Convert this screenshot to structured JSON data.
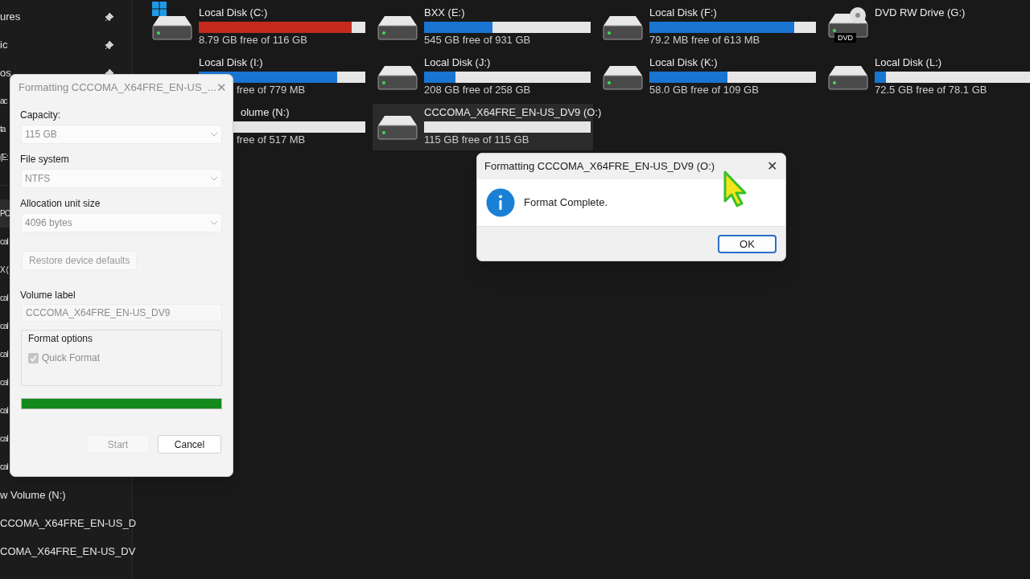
{
  "sidebar": {
    "sections": [
      {
        "items": [
          {
            "label": "ures",
            "pinned": true,
            "selected": false
          },
          {
            "label": "ic",
            "pinned": true,
            "selected": false
          },
          {
            "label": "os",
            "pinned": true,
            "selected": false
          },
          {
            "label": "ac",
            "selected": false
          },
          {
            "label": "ta",
            "selected": false
          },
          {
            "label": "(E:",
            "selected": false
          }
        ]
      },
      {
        "items": [
          {
            "label": "PC",
            "selected": true
          },
          {
            "label": "cal",
            "selected": false
          },
          {
            "label": "X (",
            "selected": false
          },
          {
            "label": "cal",
            "selected": false
          },
          {
            "label": "cal",
            "selected": false
          },
          {
            "label": "cal",
            "selected": false
          },
          {
            "label": "cal",
            "selected": false
          },
          {
            "label": "cal",
            "selected": false
          },
          {
            "label": "cal",
            "selected": false
          },
          {
            "label": "cal",
            "selected": false
          },
          {
            "label": "w Volume (N:)",
            "selected": false
          },
          {
            "label": "CCOMA_X64FRE_EN-US_D",
            "selected": false
          },
          {
            "label": "COMA_X64FRE_EN-US_DV",
            "selected": false
          }
        ]
      }
    ]
  },
  "drives": [
    {
      "kind": "disk",
      "label": "Local Disk (C:)",
      "level": 0.92,
      "low_space": true,
      "space": "8.79 GB free of 116 GB",
      "system": true,
      "selected": false
    },
    {
      "kind": "disk",
      "label": "BXX (E:)",
      "level": 0.41,
      "low_space": false,
      "space": "545 GB free of 931 GB",
      "system": false,
      "selected": false
    },
    {
      "kind": "disk",
      "label": "Local Disk (F:)",
      "level": 0.87,
      "low_space": false,
      "space": "79.2 MB free of 613 MB",
      "system": false,
      "selected": false
    },
    {
      "kind": "dvd",
      "label": "DVD RW Drive (G:)",
      "badge": "DVD",
      "selected": false
    },
    {
      "kind": "disk",
      "label": "Local Disk (I:)",
      "level": 0.83,
      "low_space": false,
      "space": "free of 779 MB",
      "selected": false
    },
    {
      "kind": "disk",
      "label": "Local Disk (J:)",
      "level": 0.19,
      "low_space": false,
      "space": "208 GB free of 258 GB",
      "system": false,
      "selected": false
    },
    {
      "kind": "disk",
      "label": "Local Disk (K:)",
      "level": 0.47,
      "low_space": false,
      "space": "58.0 GB free of 109 GB",
      "system": false,
      "selected": false
    },
    {
      "kind": "disk",
      "label": "Local Disk (L:)",
      "level": 0.07,
      "low_space": false,
      "space": "72.5 GB free of 78.1 GB",
      "system": false,
      "selected": false
    },
    {
      "kind": "disk",
      "label": "olume (N:)",
      "level": 0,
      "space": "free of 517 MB",
      "selected": false
    },
    {
      "kind": "disk",
      "label": "CCCOMA_X64FRE_EN-US_DV9 (O:)",
      "level": 0,
      "space": "115 GB free of 115 GB",
      "system": false,
      "selected": true
    }
  ],
  "format_dialog": {
    "title": "Formatting CCCOMA_X64FRE_EN-US_...",
    "close": "✕",
    "selects": [
      {
        "label": "Capacity:",
        "value": "115 GB"
      },
      {
        "label": "File system",
        "value": "NTFS"
      },
      {
        "label": "Allocation unit size",
        "value": "4096 bytes"
      }
    ],
    "restore_button": {
      "label": "Restore device defaults",
      "disabled": true
    },
    "volume_label": {
      "label": "Volume label",
      "value": "CCCOMA_X64FRE_EN-US_DV9"
    },
    "format_options": {
      "legend": "Format options",
      "quick_format": {
        "label": "Quick Format",
        "checked": true,
        "disabled": true
      }
    },
    "progress": {
      "level": 1
    },
    "buttons": [
      {
        "label": "Start",
        "disabled": true
      },
      {
        "label": "Cancel",
        "disabled": false
      }
    ]
  },
  "message_box": {
    "title": "Formatting CCCOMA_X64FRE_EN-US_DV9 (O:)",
    "close": "✕",
    "message": "Format Complete.",
    "button": "OK"
  }
}
